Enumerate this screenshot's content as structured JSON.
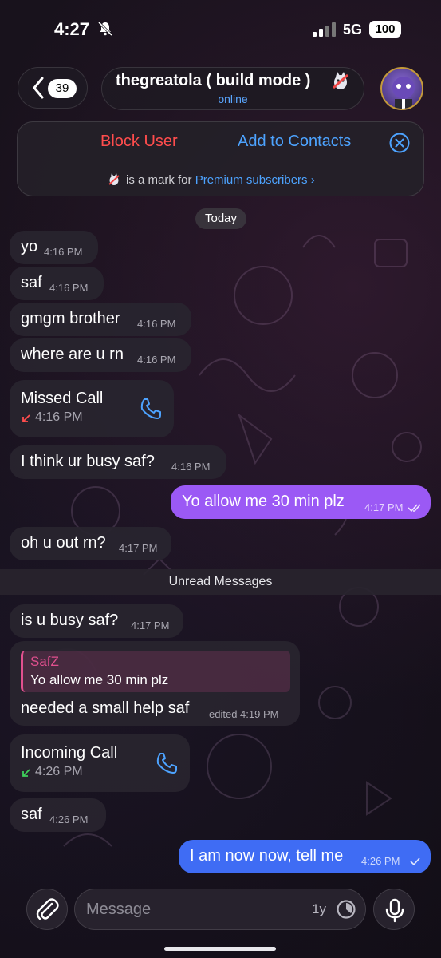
{
  "status_bar": {
    "time": "4:27",
    "network": "5G",
    "battery": "100"
  },
  "header": {
    "back_count": "39",
    "title": "thegreatola ( build mode )",
    "status": "online"
  },
  "action_panel": {
    "block_label": "Block User",
    "add_label": "Add to Contacts",
    "premium_text": "is a mark for",
    "premium_link": "Premium subscribers ›"
  },
  "date_label": "Today",
  "unread_label": "Unread Messages",
  "messages": [
    {
      "text": "yo",
      "time": "4:16 PM",
      "dir": "in"
    },
    {
      "text": "saf",
      "time": "4:16 PM",
      "dir": "in"
    },
    {
      "text": "gmgm brother",
      "time": "4:16 PM",
      "dir": "in"
    },
    {
      "text": "where are u rn",
      "time": "4:16 PM",
      "dir": "in"
    },
    {
      "call_title": "Missed Call",
      "time": "4:16 PM",
      "dir": "in"
    },
    {
      "text": "I think ur busy saf?",
      "time": "4:16 PM",
      "dir": "in"
    },
    {
      "text": "Yo allow me 30 min plz",
      "time": "4:17 PM",
      "dir": "out"
    },
    {
      "text": "oh u out rn?",
      "time": "4:17 PM",
      "dir": "in"
    },
    {
      "text": "is u busy saf?",
      "time": "4:17 PM",
      "dir": "in"
    },
    {
      "reply_name": "SafZ",
      "reply_text": "Yo allow me 30 min plz",
      "text": "needed a small help saf",
      "time": "edited 4:19 PM",
      "dir": "in"
    },
    {
      "call_title": "Incoming Call",
      "time": "4:26 PM",
      "dir": "in"
    },
    {
      "text": "saf",
      "time": "4:26 PM",
      "dir": "in"
    },
    {
      "text": "I am now now, tell me",
      "time": "4:26 PM",
      "dir": "out"
    }
  ],
  "input": {
    "placeholder": "Message",
    "timer": "1y"
  },
  "colors": {
    "outgoing_purple": "#9b59f5",
    "outgoing_blue": "#3f6cf4",
    "link": "#4da3ff",
    "danger": "#ff4d4d",
    "reply_accent": "#e2508f"
  },
  "icons": [
    "bell-slash-icon",
    "signal-icon",
    "back-chevron-icon",
    "close-icon",
    "premium-badge-icon",
    "phone-icon",
    "missed-call-arrow-icon",
    "incoming-call-arrow-icon",
    "double-check-icon",
    "attach-icon",
    "timer-icon",
    "mic-icon"
  ]
}
